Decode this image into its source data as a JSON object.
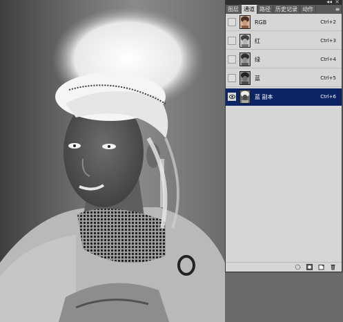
{
  "panel": {
    "tabs": [
      {
        "label": "图层",
        "active": false
      },
      {
        "label": "通道",
        "active": true
      },
      {
        "label": "路径",
        "active": false
      },
      {
        "label": "历史记录",
        "active": false
      },
      {
        "label": "动作",
        "active": false
      }
    ],
    "collapse_glyph": "◂◂",
    "close_glyph": "×",
    "menu_glyph": "≡",
    "channels": [
      {
        "name": "RGB",
        "shortcut": "Ctrl+2",
        "visible": false,
        "selected": false,
        "thumb": "color"
      },
      {
        "name": "红",
        "shortcut": "Ctrl+3",
        "visible": false,
        "selected": false,
        "thumb": "gray-light"
      },
      {
        "name": "绿",
        "shortcut": "Ctrl+4",
        "visible": false,
        "selected": false,
        "thumb": "gray"
      },
      {
        "name": "蓝",
        "shortcut": "Ctrl+5",
        "visible": false,
        "selected": false,
        "thumb": "gray-dark"
      },
      {
        "name": "蓝 副本",
        "shortcut": "Ctrl+6",
        "visible": true,
        "selected": true,
        "thumb": "inverted"
      }
    ],
    "toolbar_icons": [
      "load-selection-icon",
      "save-selection-icon",
      "new-channel-icon",
      "trash-icon"
    ]
  },
  "colors": {
    "selection_highlight": "#0a2466",
    "panel_bg": "#d6d6d6",
    "tab_strip": "#5b5b5b"
  }
}
